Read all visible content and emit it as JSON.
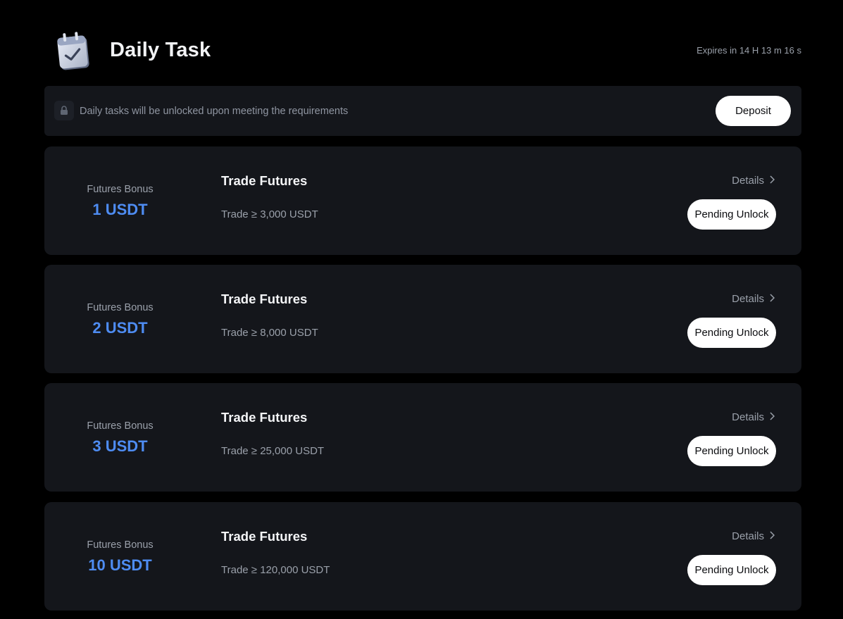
{
  "header": {
    "title": "Daily Task",
    "expires": "Expires in 14 H 13 m 16 s",
    "icon": "calendar-check-icon"
  },
  "notice": {
    "text": "Daily tasks will be unlocked upon meeting the requirements",
    "deposit_label": "Deposit",
    "icon": "lock-icon"
  },
  "colors": {
    "background": "#000000",
    "card": "#14161b",
    "accent": "#4e8cf2",
    "muted_text": "#9aa0aa"
  },
  "tasks": [
    {
      "bonus_label": "Futures Bonus",
      "bonus_amount": "1 USDT",
      "title": "Trade Futures",
      "requirement": "Trade ≥ 3,000 USDT",
      "details_label": "Details",
      "action_label": "Pending Unlock"
    },
    {
      "bonus_label": "Futures Bonus",
      "bonus_amount": "2 USDT",
      "title": "Trade Futures",
      "requirement": "Trade ≥ 8,000 USDT",
      "details_label": "Details",
      "action_label": "Pending Unlock"
    },
    {
      "bonus_label": "Futures Bonus",
      "bonus_amount": "3 USDT",
      "title": "Trade Futures",
      "requirement": "Trade ≥ 25,000 USDT",
      "details_label": "Details",
      "action_label": "Pending Unlock"
    },
    {
      "bonus_label": "Futures Bonus",
      "bonus_amount": "10 USDT",
      "title": "Trade Futures",
      "requirement": "Trade ≥ 120,000 USDT",
      "details_label": "Details",
      "action_label": "Pending Unlock"
    }
  ]
}
